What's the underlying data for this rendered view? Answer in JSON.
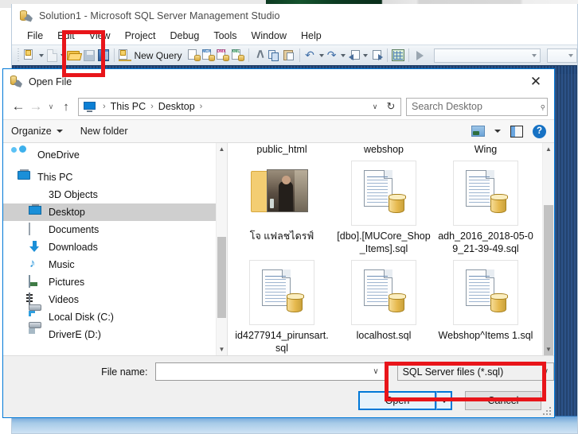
{
  "host_app": {
    "title": "Solution1 - Microsoft SQL Server Management Studio",
    "icon": "ssms-icon",
    "menu": [
      "File",
      "Edit",
      "View",
      "Project",
      "Debug",
      "Tools",
      "Window",
      "Help"
    ],
    "toolbar": {
      "new_query_label": "New Query",
      "buttons": [
        "new-project-icon",
        "new-item-icon",
        "open-file-icon",
        "save-icon",
        "save-all-icon",
        "new-query-icon",
        "new-database-engine-query-icon",
        "new-mdx-query-icon",
        "new-dmx-query-icon",
        "new-xmla-query-icon",
        "cut-icon",
        "copy-icon",
        "paste-icon",
        "undo-icon",
        "redo-icon",
        "navigate-backward-icon",
        "navigate-forward-icon",
        "object-explorer-icon",
        "run-icon"
      ]
    }
  },
  "dialog": {
    "title": "Open File",
    "title_icon": "ssms-icon",
    "close_label": "✕",
    "nav": {
      "back": "←",
      "forward": "→",
      "recent": "∨",
      "up": "↑"
    },
    "address": {
      "icon": "this-pc-icon",
      "crumbs": [
        "This PC",
        "Desktop"
      ],
      "separator": "›",
      "dropdown": "∨",
      "refresh": "↻"
    },
    "search": {
      "placeholder": "Search Desktop",
      "value": "",
      "icon": "search-icon"
    },
    "commandbar": {
      "organize": "Organize",
      "new_folder": "New folder",
      "view_icon": "change-view-icon",
      "view_caret": "▾",
      "preview_icon": "preview-pane-icon",
      "help_icon": "help-icon",
      "help_glyph": "?"
    },
    "navpane": {
      "items": [
        {
          "label": "OneDrive",
          "icon": "onedrive-icon",
          "indent": false,
          "selected": false
        },
        {
          "label": "This PC",
          "icon": "this-pc-icon",
          "indent": false,
          "selected": false
        },
        {
          "label": "3D Objects",
          "icon": "3d-objects-icon",
          "indent": true,
          "selected": false
        },
        {
          "label": "Desktop",
          "icon": "desktop-icon",
          "indent": true,
          "selected": true
        },
        {
          "label": "Documents",
          "icon": "documents-icon",
          "indent": true,
          "selected": false
        },
        {
          "label": "Downloads",
          "icon": "downloads-icon",
          "indent": true,
          "selected": false
        },
        {
          "label": "Music",
          "icon": "music-icon",
          "indent": true,
          "selected": false
        },
        {
          "label": "Pictures",
          "icon": "pictures-icon",
          "indent": true,
          "selected": false
        },
        {
          "label": "Videos",
          "icon": "videos-icon",
          "indent": true,
          "selected": false
        },
        {
          "label": "Local Disk (C:)",
          "icon": "local-disk-icon",
          "indent": true,
          "selected": false
        },
        {
          "label": "DriverE (D:)",
          "icon": "drive-icon",
          "indent": true,
          "selected": false
        }
      ]
    },
    "files": {
      "clipped_top_labels": [
        "public_html",
        "webshop",
        "Wing"
      ],
      "row1": [
        {
          "name": "โจ แฟลชไดรฟ์",
          "icon": "folder-with-picture-icon",
          "type": "folder"
        },
        {
          "name": "[dbo].[MUCore_Shop_Items].sql",
          "icon": "sql-file-icon",
          "type": "file"
        },
        {
          "name": "adh_2016_2018-05-09_21-39-49.sql",
          "icon": "sql-file-icon",
          "type": "file"
        }
      ],
      "row2": [
        {
          "name": "id4277914_pirunsart.sql",
          "icon": "sql-file-icon",
          "type": "file"
        },
        {
          "name": "localhost.sql",
          "icon": "sql-file-icon",
          "type": "file"
        },
        {
          "name": "Webshop^Items 1.sql",
          "icon": "sql-file-icon",
          "type": "file"
        }
      ]
    },
    "footer": {
      "filename_label": "File name:",
      "filename_value": "",
      "filename_caret": "∨",
      "filetype_value": "SQL Server files (*.sql)",
      "filetype_caret": "∨",
      "open_label": "Open",
      "open_split_caret": "▼",
      "cancel_label": "Cancel"
    }
  },
  "annotations": {
    "accent_color": "#e8151a",
    "boxes": [
      {
        "name": "open-file-toolbar-highlight",
        "target": "open-file-icon"
      },
      {
        "name": "file-type-dropdown-highlight",
        "target": "filetype-dropdown"
      }
    ]
  }
}
